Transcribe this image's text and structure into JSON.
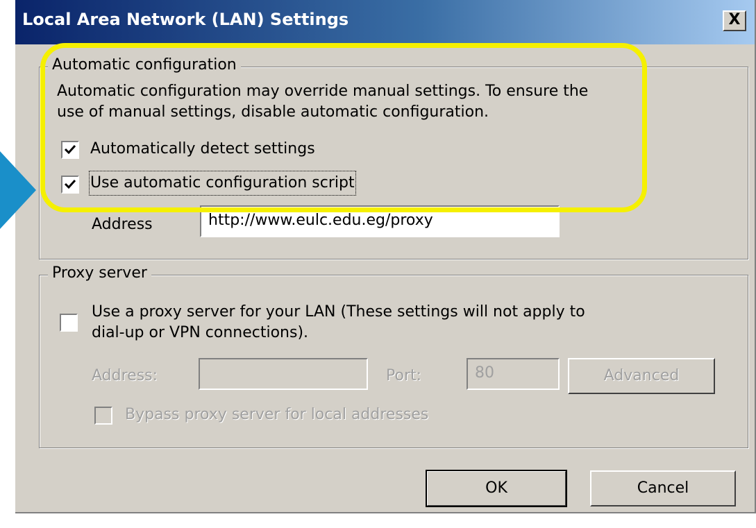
{
  "window": {
    "title": "Local Area Network (LAN) Settings",
    "close_label": "X"
  },
  "auto_config": {
    "group_label": "Automatic configuration",
    "description_line1": "Automatic configuration may override manual settings.  To ensure the",
    "description_line2": "use of manual settings, disable automatic configuration.",
    "detect_label": "Automatically detect settings",
    "detect_checked": true,
    "script_label": "Use automatic configuration script",
    "script_checked": true,
    "address_label": "Address",
    "address_value": "http://www.eulc.edu.eg/proxy"
  },
  "proxy": {
    "group_label": "Proxy server",
    "use_proxy_line1": "Use a proxy server for your LAN (These settings will not apply to",
    "use_proxy_line2": "dial-up or VPN connections).",
    "use_proxy_checked": false,
    "address_label": "Address:",
    "address_value": "",
    "port_label": "Port:",
    "port_value": "80",
    "advanced_label": "Advanced",
    "bypass_label": "Bypass proxy server for local addresses",
    "bypass_checked": false
  },
  "buttons": {
    "ok": "OK",
    "cancel": "Cancel"
  },
  "colors": {
    "highlight": "#f5f000",
    "arrow": "#1a8fc9",
    "title_start": "#0a246a",
    "title_end": "#a6caf0"
  }
}
